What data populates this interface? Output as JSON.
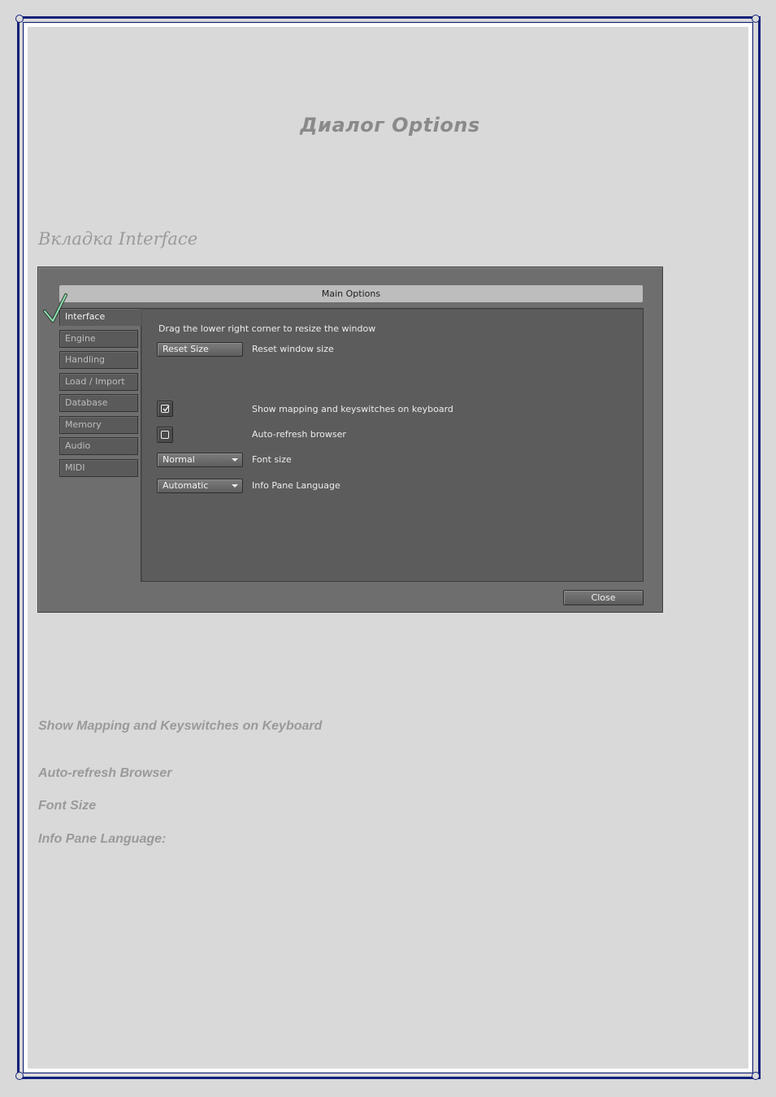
{
  "document": {
    "title": "Диалог Options",
    "section_heading": "Вкладка Interface"
  },
  "dialog": {
    "title": "Main Options",
    "tabs": [
      {
        "label": "Interface",
        "active": true
      },
      {
        "label": "Engine",
        "active": false
      },
      {
        "label": "Handling",
        "active": false
      },
      {
        "label": "Load / Import",
        "active": false
      },
      {
        "label": "Database",
        "active": false
      },
      {
        "label": "Memory",
        "active": false
      },
      {
        "label": "Audio",
        "active": false
      },
      {
        "label": "MIDI",
        "active": false
      }
    ],
    "resize_hint": "Drag the lower right corner to resize the window",
    "reset_button": "Reset Size",
    "reset_desc": "Reset window size",
    "show_mapping": {
      "label": "Show mapping and keyswitches on keyboard",
      "checked": true
    },
    "auto_refresh": {
      "label": "Auto-refresh browser",
      "checked": false
    },
    "font_size": {
      "value": "Normal",
      "label": "Font size"
    },
    "info_pane_language": {
      "value": "Automatic",
      "label": "Info Pane Language"
    },
    "close_button": "Close"
  },
  "descriptions": [
    "Show Mapping and Keyswitches on Keyboard",
    "Auto-refresh Browser",
    "Font Size",
    "Info Pane Language:"
  ],
  "colors": {
    "frame": "#10207a",
    "page_background": "#d9d9d9",
    "dialog_background": "#6e6e6e",
    "panel_background": "#5c5c5c",
    "check_mark": "#8fe0b0"
  }
}
